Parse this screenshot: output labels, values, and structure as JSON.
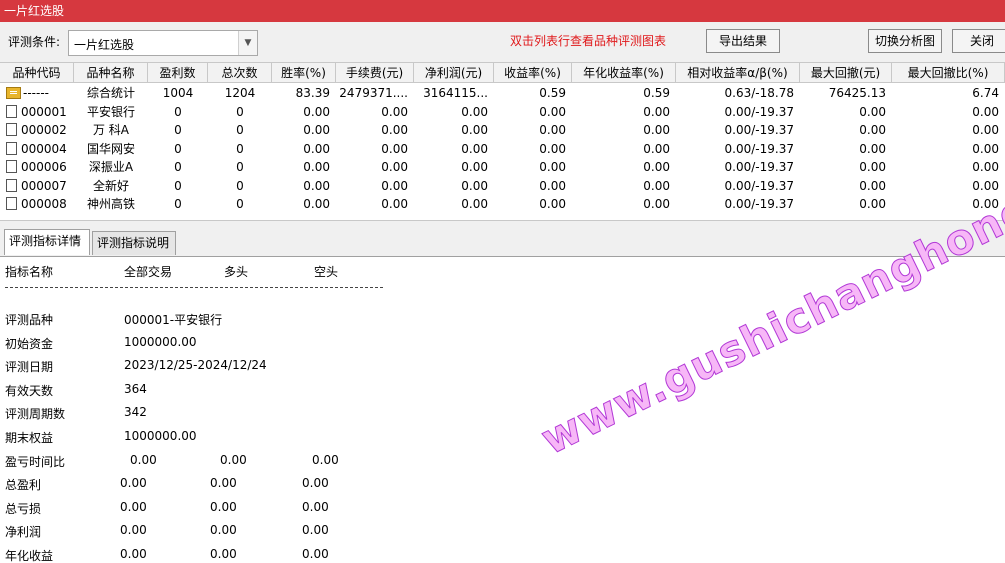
{
  "window": {
    "title": "一片红选股"
  },
  "toolbar": {
    "condition_label": "评测条件:",
    "condition_value": "一片红选股",
    "hint": "双击列表行查看品种评测图表",
    "export_label": "导出结果",
    "switch_label": "切换分析图",
    "close_label": "关闭"
  },
  "table": {
    "headers": [
      "品种代码",
      "品种名称",
      "盈利数",
      "总次数",
      "胜率(%)",
      "手续费(元)",
      "净利润(元)",
      "收益率(%)",
      "年化收益率(%)",
      "相对收益率α/β(%)",
      "最大回撤(元)",
      "最大回撤比(%)"
    ],
    "rows": [
      [
        "------",
        "综合统计",
        "1004",
        "1204",
        "83.39",
        "2479371....",
        "3164115...",
        "0.59",
        "0.59",
        "0.63/-18.78",
        "76425.13",
        "6.74"
      ],
      [
        "000001",
        "平安银行",
        "0",
        "0",
        "0.00",
        "0.00",
        "0.00",
        "0.00",
        "0.00",
        "0.00/-19.37",
        "0.00",
        "0.00"
      ],
      [
        "000002",
        "万 科A",
        "0",
        "0",
        "0.00",
        "0.00",
        "0.00",
        "0.00",
        "0.00",
        "0.00/-19.37",
        "0.00",
        "0.00"
      ],
      [
        "000004",
        "国华网安",
        "0",
        "0",
        "0.00",
        "0.00",
        "0.00",
        "0.00",
        "0.00",
        "0.00/-19.37",
        "0.00",
        "0.00"
      ],
      [
        "000006",
        "深振业A",
        "0",
        "0",
        "0.00",
        "0.00",
        "0.00",
        "0.00",
        "0.00",
        "0.00/-19.37",
        "0.00",
        "0.00"
      ],
      [
        "000007",
        "全新好",
        "0",
        "0",
        "0.00",
        "0.00",
        "0.00",
        "0.00",
        "0.00",
        "0.00/-19.37",
        "0.00",
        "0.00"
      ],
      [
        "000008",
        "神州高铁",
        "0",
        "0",
        "0.00",
        "0.00",
        "0.00",
        "0.00",
        "0.00",
        "0.00/-19.37",
        "0.00",
        "0.00"
      ]
    ]
  },
  "tabs": [
    "评测指标详情",
    "评测指标说明"
  ],
  "detail": {
    "header": [
      "指标名称",
      "全部交易",
      "多头",
      "空头"
    ],
    "lines": [
      {
        "label": "评测品种",
        "values": [
          "000001-平安银行"
        ]
      },
      {
        "label": "初始资金",
        "values": [
          "1000000.00"
        ]
      },
      {
        "label": "评测日期",
        "values": [
          "2023/12/25-2024/12/24"
        ]
      },
      {
        "label": "有效天数",
        "values": [
          "364"
        ]
      },
      {
        "label": "评测周期数",
        "values": [
          "342"
        ]
      },
      {
        "label": "期末权益",
        "values": [
          "1000000.00"
        ]
      },
      {
        "label": "盈亏时间比",
        "values": [
          "0.00",
          "0.00",
          "0.00"
        ]
      },
      {
        "label": "总盈利",
        "values": [
          "0.00",
          "0.00",
          "0.00"
        ]
      },
      {
        "label": "总亏损",
        "values": [
          "0.00",
          "0.00",
          "0.00"
        ]
      },
      {
        "label": "净利润",
        "values": [
          "0.00",
          "0.00",
          "0.00"
        ]
      },
      {
        "label": "年化收益",
        "values": [
          "0.00",
          "0.00",
          "0.00"
        ]
      }
    ]
  },
  "watermark": "www.gushichanghong.com",
  "colors": {
    "titlebar": "#d6383f",
    "hint": "#e0191b",
    "watermark": "#f7b7f7"
  }
}
